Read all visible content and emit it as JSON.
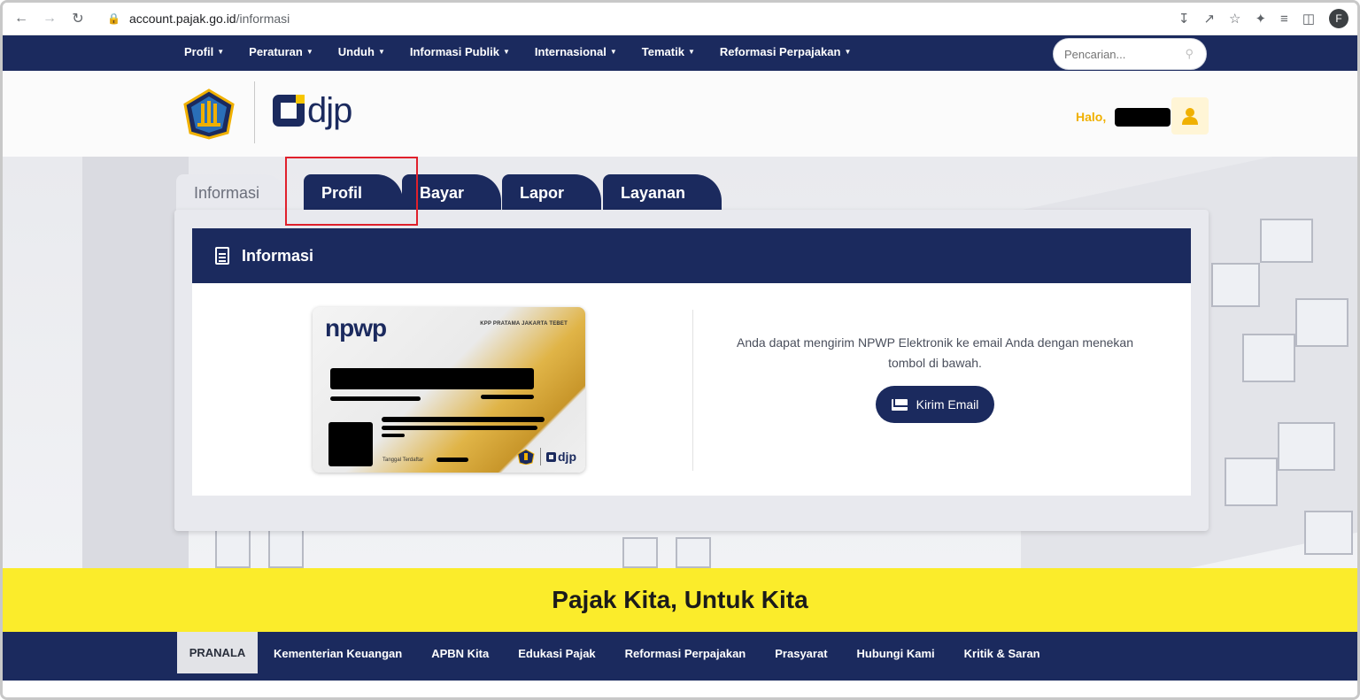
{
  "browser": {
    "url_domain": "account.pajak.go.id",
    "url_path": "/informasi",
    "profile_initial": "F"
  },
  "topnav": {
    "items": [
      "Profil",
      "Peraturan",
      "Unduh",
      "Informasi Publik",
      "Internasional",
      "Tematik",
      "Reformasi Perpajakan"
    ],
    "search_placeholder": "Pencarian..."
  },
  "header": {
    "logo_text": "djp",
    "greeting": "Halo,"
  },
  "tabs": [
    "Informasi",
    "Profil",
    "Bayar",
    "Lapor",
    "Layanan"
  ],
  "panel": {
    "title": "Informasi",
    "npwp_brand": "npwp",
    "kpp_text": "KPP PRATAMA JAKARTA TEBET",
    "registered_label": "Tanggal Terdaftar",
    "card_logo": "djp",
    "info_text": "Anda dapat mengirim NPWP Elektronik ke email Anda dengan menekan tombol di bawah.",
    "email_button": "Kirim Email"
  },
  "slogan": "Pajak Kita, Untuk Kita",
  "footer": {
    "pranala": "PRANALA",
    "links": [
      "Kementerian Keuangan",
      "APBN Kita",
      "Edukasi Pajak",
      "Reformasi Perpajakan",
      "Prasyarat",
      "Hubungi Kami",
      "Kritik & Saran"
    ]
  },
  "colors": {
    "navy": "#1b2a5e",
    "yellow": "#fbec2b",
    "gold": "#f0b000",
    "highlight_red": "#e0202b"
  }
}
